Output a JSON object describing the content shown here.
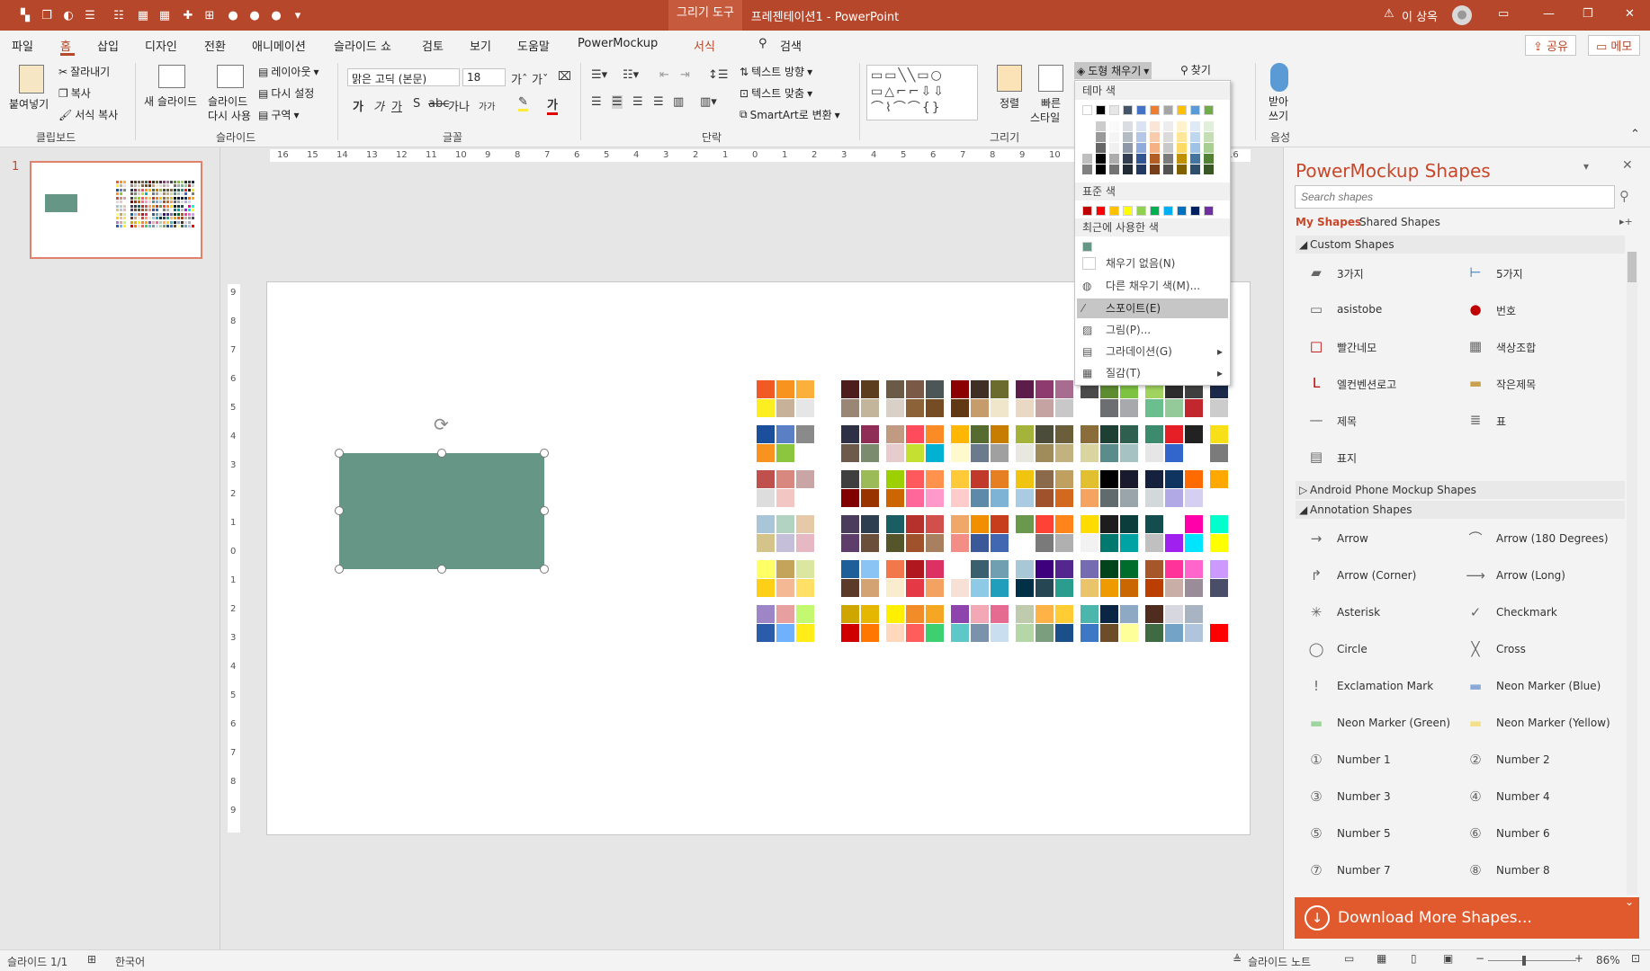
{
  "titlebar": {
    "doc_title": "프레젠테이션1 - PowerPoint",
    "context_tab": "그리기 도구",
    "user": "이 상옥",
    "warn_icon": "warning-icon"
  },
  "tabs": [
    {
      "label": "파일"
    },
    {
      "label": "홈"
    },
    {
      "label": "삽입"
    },
    {
      "label": "디자인"
    },
    {
      "label": "전환"
    },
    {
      "label": "애니메이션"
    },
    {
      "label": "슬라이드 쇼"
    },
    {
      "label": "검토"
    },
    {
      "label": "보기"
    },
    {
      "label": "도움말"
    },
    {
      "label": "PowerMockup"
    },
    {
      "label": "서식"
    }
  ],
  "search_label": "검색",
  "share_label": "공유",
  "memo_label": "메모",
  "ribbon": {
    "clipboard": {
      "paste": "붙여넣기",
      "cut": "잘라내기",
      "copy": "복사",
      "format_painter": "서식 복사",
      "label": "클립보드"
    },
    "slides": {
      "new_slide": "새 슬라이드",
      "reuse_1": "슬라이드",
      "reuse_2": "다시 사용",
      "layout": "레이아웃",
      "reset": "다시 설정",
      "section": "구역",
      "label": "슬라이드"
    },
    "font": {
      "name": "맑은 고딕 (본문)",
      "size": "18",
      "label": "글꼴",
      "bold": "가",
      "italic": "가",
      "underline": "가",
      "shadow": "S",
      "strike": "abc",
      "spacing": "AV",
      "case": "가나",
      "clear": "가가"
    },
    "paragraph": {
      "text_direction": "텍스트 방향",
      "align_text": "텍스트 맞춤",
      "smartart": "SmartArt로 변환",
      "label": "단락"
    },
    "drawing": {
      "arrange": "정렬",
      "quick_styles_1": "빠른",
      "quick_styles_2": "스타일",
      "shape_fill": "도형 채우기",
      "label": "그리기"
    },
    "editing": {
      "find": "찾기"
    },
    "voice": {
      "dictate_1": "받아",
      "dictate_2": "쓰기",
      "label": "음성"
    }
  },
  "fill_menu": {
    "theme_colors": "테마 색",
    "standard_colors": "표준 색",
    "recent_colors": "최근에 사용한 색",
    "no_fill": "채우기 없음(N)",
    "more_colors": "다른 채우기 색(M)...",
    "eyedropper": "스포이트(E)",
    "picture": "그림(P)...",
    "gradient": "그라데이션(G)",
    "texture": "질감(T)",
    "theme_top": [
      "#ffffff",
      "#000000",
      "#e7e6e6",
      "#44546a",
      "#4472c4",
      "#ed7d31",
      "#a5a5a5",
      "#ffc000",
      "#5b9bd5",
      "#70ad47"
    ],
    "standard": [
      "#c00000",
      "#ff0000",
      "#ffc000",
      "#ffff00",
      "#92d050",
      "#00b050",
      "#00b0f0",
      "#0070c0",
      "#002060",
      "#7030a0"
    ],
    "recent": [
      "#669685"
    ]
  },
  "ruler": {
    "h_ticks": [
      "16",
      "15",
      "14",
      "13",
      "12",
      "11",
      "10",
      "9",
      "8",
      "7",
      "6",
      "5",
      "4",
      "3",
      "2",
      "1",
      "0",
      "1",
      "2",
      "3",
      "4",
      "5",
      "6",
      "7",
      "8",
      "9",
      "10",
      "11",
      "12",
      "13",
      "14",
      "15",
      "16"
    ],
    "v_ticks": [
      "9",
      "8",
      "7",
      "6",
      "5",
      "4",
      "3",
      "2",
      "1",
      "0",
      "1",
      "2",
      "3",
      "4",
      "5",
      "6",
      "7",
      "8",
      "9"
    ]
  },
  "thumbnail": {
    "number": "1"
  },
  "shape_color": "#669685",
  "palette_rows": [
    [
      "#f15a24",
      "#f7931e",
      "#fbb03b",
      "#ffffff",
      "#4d1c1c",
      "#5c3d1e",
      "#6b5a45",
      "#7a5a47",
      "#4d5656",
      "#8b0000",
      "#3f2f25",
      "#6b6b2e",
      "#5c1d4a",
      "#8e3b70",
      "#a76c8f",
      "#4b4b4b",
      "#5e8c31",
      "#7ec242",
      "#a1d45e",
      "#2d2d2d",
      "#404040",
      "#1b2a4a"
    ],
    [
      "#fcee21",
      "#c7b299",
      "#e6e6e6",
      "#ffffff",
      "#998675",
      "#c2b59b",
      "#d9d1c7",
      "#8c6239",
      "#754c24",
      "#603813",
      "#c69c6d",
      "#f0e6cc",
      "#e8d8c4",
      "#c5a3a3",
      "#c8c8c8",
      "#ffffff",
      "#6d6e71",
      "#a7a9ac",
      "#6bbf8f",
      "#94c99a",
      "#c1272d",
      "#cccccc"
    ],
    [
      "#1b4f9c",
      "#5b7fc4",
      "#8a8a8a",
      "#ffffff",
      "#2e3046",
      "#8f2d56",
      "#c19a82",
      "#ff4b5c",
      "#fb8b24",
      "#ffb703",
      "#556b2f",
      "#c77c02",
      "#a4b43a",
      "#4c4c3b",
      "#6b5e3a",
      "#8a6d3b",
      "#1e3f34",
      "#2f5f4f",
      "#3d8b6d",
      "#e61e25",
      "#222222",
      "#f7e018"
    ],
    [
      "#f7931e",
      "#8cc63f",
      "#ffffff",
      "#ffffff",
      "#6e5a4a",
      "#7b8c6e",
      "#e6cccc",
      "#c6e032",
      "#00b1d2",
      "#fffacd",
      "#6b7b8c",
      "#a0a0a0",
      "#e8e8e0",
      "#a08c5b",
      "#c2b280",
      "#d9d4a0",
      "#5b8c8c",
      "#a6c2c2",
      "#e6e6e6",
      "#3366cc",
      "#ffffff",
      "#7b7b7b"
    ],
    [
      "#c0504d",
      "#d98880",
      "#c9a5a5",
      "#ffffff",
      "#3f3f3f",
      "#9bbb59",
      "#9cd000",
      "#ff595e",
      "#ff924c",
      "#ffca3a",
      "#c0392b",
      "#e67e22",
      "#f1c40f",
      "#8a6a4a",
      "#c0a060",
      "#e0c030",
      "#000000",
      "#1a1a2e",
      "#16213e",
      "#0f3460",
      "#ff6b00",
      "#ffa800"
    ],
    [
      "#dddddd",
      "#f2c6c2",
      "#ffffff",
      "#ffffff",
      "#800000",
      "#993300",
      "#cc6600",
      "#ff6699",
      "#ff99cc",
      "#ffcccc",
      "#5d8aa8",
      "#7fb3d5",
      "#a9cce3",
      "#a0522d",
      "#d2691e",
      "#f4a460",
      "#5f6b6d",
      "#9aa5ab",
      "#d3d8da",
      "#b0a9e6",
      "#d5d0f2",
      "#ffffff"
    ],
    [
      "#a9c6d9",
      "#b2d3c2",
      "#e6c9a8",
      "#ffffff",
      "#4b3b5c",
      "#2c3e50",
      "#1a5e63",
      "#b7312c",
      "#d1504b",
      "#f0a868",
      "#f18f01",
      "#c73e1d",
      "#6a994e",
      "#ff4136",
      "#ff851b",
      "#ffdc00",
      "#1d1d1d",
      "#0b3d3d",
      "#144d4d",
      "#ffffff",
      "#ff00aa",
      "#00ffcc"
    ],
    [
      "#d4c48a",
      "#c5bfd9",
      "#e6b8c4",
      "#ffffff",
      "#5e3d6b",
      "#6b4f3a",
      "#55552b",
      "#a0522d",
      "#a88060",
      "#f28e85",
      "#3b5998",
      "#4267b2",
      "#ffffff",
      "#7a7a7a",
      "#b0b0b0",
      "#f2f2f2",
      "#01796f",
      "#00a3a3",
      "#c0c0c0",
      "#a020f0",
      "#00e5ff",
      "#ffff00"
    ],
    [
      "#ffff66",
      "#c4a35a",
      "#dbe6a0",
      "#ffffff",
      "#1f5f99",
      "#89c4f4",
      "#f2784b",
      "#b0171f",
      "#de3163",
      "#ffffff",
      "#3a5f6f",
      "#6f9fb0",
      "#a8c8d8",
      "#3f007d",
      "#54278f",
      "#756bb1",
      "#00441b",
      "#006d2c",
      "#a65628",
      "#ff3399",
      "#ff66cc",
      "#cc99ff"
    ],
    [
      "#fdd017",
      "#f5b895",
      "#ffe066",
      "#ffffff",
      "#5b3a29",
      "#d4a373",
      "#faedcd",
      "#e63946",
      "#f4a261",
      "#f7e1d7",
      "#8ecae6",
      "#219ebc",
      "#023047",
      "#264653",
      "#2a9d8f",
      "#e9c46a",
      "#ee9b00",
      "#ca6702",
      "#bb3e03",
      "#c9ada7",
      "#9a8c98",
      "#4a4e69"
    ],
    [
      "#9d85c6",
      "#e89f9f",
      "#c2f970",
      "#ffffff",
      "#cfa500",
      "#e5b700",
      "#ffef00",
      "#f28c28",
      "#f5a623",
      "#8e44ad",
      "#f3a8b6",
      "#e56b91",
      "#c0caad",
      "#ffb347",
      "#ffcc33",
      "#4db6ac",
      "#0b2545",
      "#8da9c4",
      "#4f2c1d",
      "#d7d7e0",
      "#a9b4c2",
      "#ffffff"
    ],
    [
      "#2a5caa",
      "#6fb1fc",
      "#ffec19",
      "#ffffff",
      "#d00000",
      "#ff7700",
      "#ffd8be",
      "#ff5c5c",
      "#3cd070",
      "#5ec8c8",
      "#7b93aa",
      "#c9deef",
      "#b5d6a7",
      "#7a9e7e",
      "#1b4f8a",
      "#3c78c4",
      "#6d4c2a",
      "#ffff99",
      "#3f6b43",
      "#74a3c8",
      "#b0c4de",
      "#ff0000"
    ]
  ],
  "panel": {
    "title": "PowerMockup Shapes",
    "search_placeholder": "Search shapes",
    "tab_mine": "My Shapes",
    "tab_shared": "Shared Shapes",
    "custom_header": "Custom Shapes",
    "custom": [
      {
        "label": "3가지",
        "icon": "shape3-icon"
      },
      {
        "label": "5가지",
        "icon": "shape5-icon"
      },
      {
        "label": "asistobe",
        "icon": "asistobe-icon"
      },
      {
        "label": "번호",
        "icon": "number-badge-icon"
      },
      {
        "label": "빨간네모",
        "icon": "red-square-icon"
      },
      {
        "label": "색상조합",
        "icon": "color-combo-icon"
      },
      {
        "label": "엘컨벤션로고",
        "icon": "logo-icon"
      },
      {
        "label": "작은제목",
        "icon": "small-title-icon"
      },
      {
        "label": "제목",
        "icon": "title-icon"
      },
      {
        "label": "표",
        "icon": "table-icon"
      },
      {
        "label": "표지",
        "icon": "cover-icon"
      }
    ],
    "android_header": "Android Phone Mockup Shapes",
    "annotation_header": "Annotation Shapes",
    "annotation": [
      {
        "label": "Arrow",
        "icon": "arrow-icon"
      },
      {
        "label": "Arrow (180 Degrees)",
        "icon": "arrow-180-icon"
      },
      {
        "label": "Arrow (Corner)",
        "icon": "arrow-corner-icon"
      },
      {
        "label": "Arrow (Long)",
        "icon": "arrow-long-icon"
      },
      {
        "label": "Asterisk",
        "icon": "asterisk-icon"
      },
      {
        "label": "Checkmark",
        "icon": "checkmark-icon"
      },
      {
        "label": "Circle",
        "icon": "circle-icon"
      },
      {
        "label": "Cross",
        "icon": "cross-icon"
      },
      {
        "label": "Exclamation Mark",
        "icon": "exclamation-icon"
      },
      {
        "label": "Neon Marker (Blue)",
        "icon": "neon-blue-icon"
      },
      {
        "label": "Neon Marker (Green)",
        "icon": "neon-green-icon"
      },
      {
        "label": "Neon Marker (Yellow)",
        "icon": "neon-yellow-icon"
      },
      {
        "label": "Number 1",
        "icon": "number1-icon"
      },
      {
        "label": "Number 2",
        "icon": "number2-icon"
      },
      {
        "label": "Number 3",
        "icon": "number3-icon"
      },
      {
        "label": "Number 4",
        "icon": "number4-icon"
      },
      {
        "label": "Number 5",
        "icon": "number5-icon"
      },
      {
        "label": "Number 6",
        "icon": "number6-icon"
      },
      {
        "label": "Number 7",
        "icon": "number7-icon"
      },
      {
        "label": "Number 8",
        "icon": "number8-icon"
      }
    ],
    "download": "Download More Shapes..."
  },
  "status": {
    "slide": "슬라이드 1/1",
    "language": "한국어",
    "notes": "슬라이드 노트",
    "zoom": "86%"
  }
}
